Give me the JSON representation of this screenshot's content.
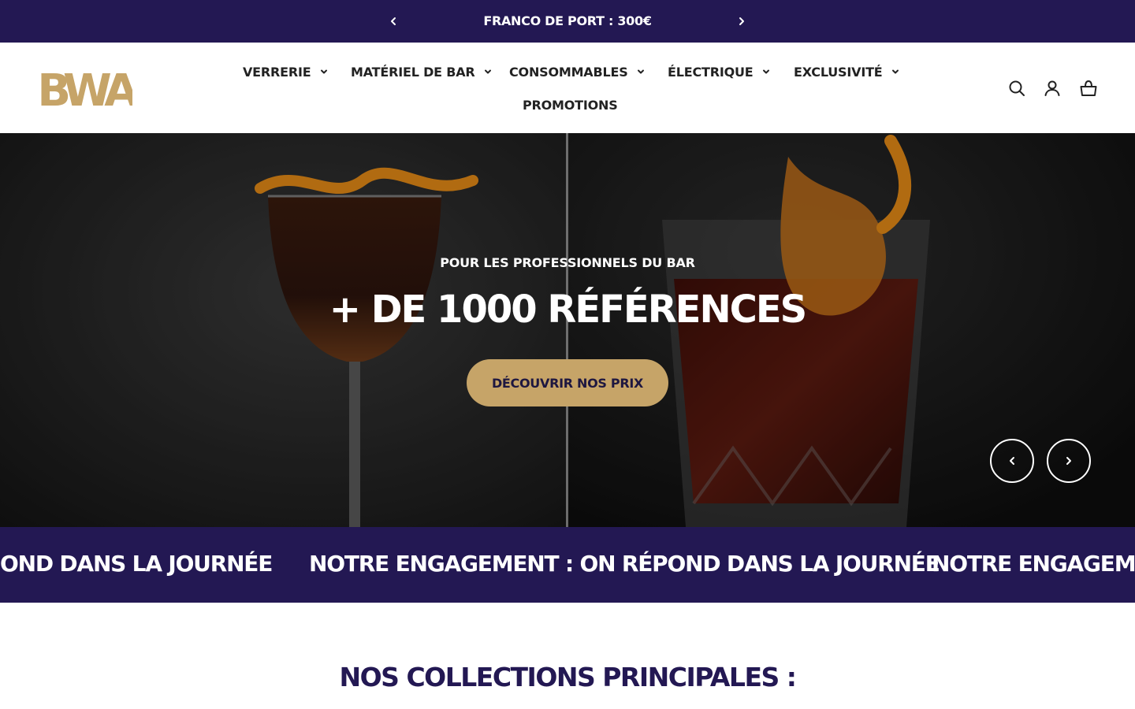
{
  "announcement": {
    "text": "FRANCO DE PORT : 300€",
    "prev_icon": "chevron-left-icon",
    "next_icon": "chevron-right-icon"
  },
  "header": {
    "logo_text": "BWA",
    "nav": [
      {
        "label": "VERRERIE",
        "has_dropdown": true
      },
      {
        "label": "MATÉRIEL DE BAR",
        "has_dropdown": true
      },
      {
        "label": "CONSOMMABLES",
        "has_dropdown": true
      },
      {
        "label": "ÉLECTRIQUE",
        "has_dropdown": true
      },
      {
        "label": "EXCLUSIVITÉ",
        "has_dropdown": true
      },
      {
        "label": "PROMOTIONS",
        "has_dropdown": false
      }
    ],
    "icons": [
      "search-icon",
      "account-icon",
      "cart-icon"
    ]
  },
  "hero": {
    "subtitle": "POUR LES PROFESSIONNELS DU BAR",
    "title": "+ DE 1000 RÉFÉRENCES",
    "cta": "DÉCOUVRIR NOS PRIX"
  },
  "marquee": {
    "text": "NOTRE ENGAGEMENT : ON RÉPOND DANS LA JOURNÉE",
    "text_partial_left": "OND DANS LA JOURNÉE",
    "text_partial_right": "NOTRE ENGAGEMEN"
  },
  "collections": {
    "title": "NOS COLLECTIONS PRINCIPALES :"
  },
  "colors": {
    "brand_navy": "#231853",
    "brand_gold": "#c6a468"
  }
}
